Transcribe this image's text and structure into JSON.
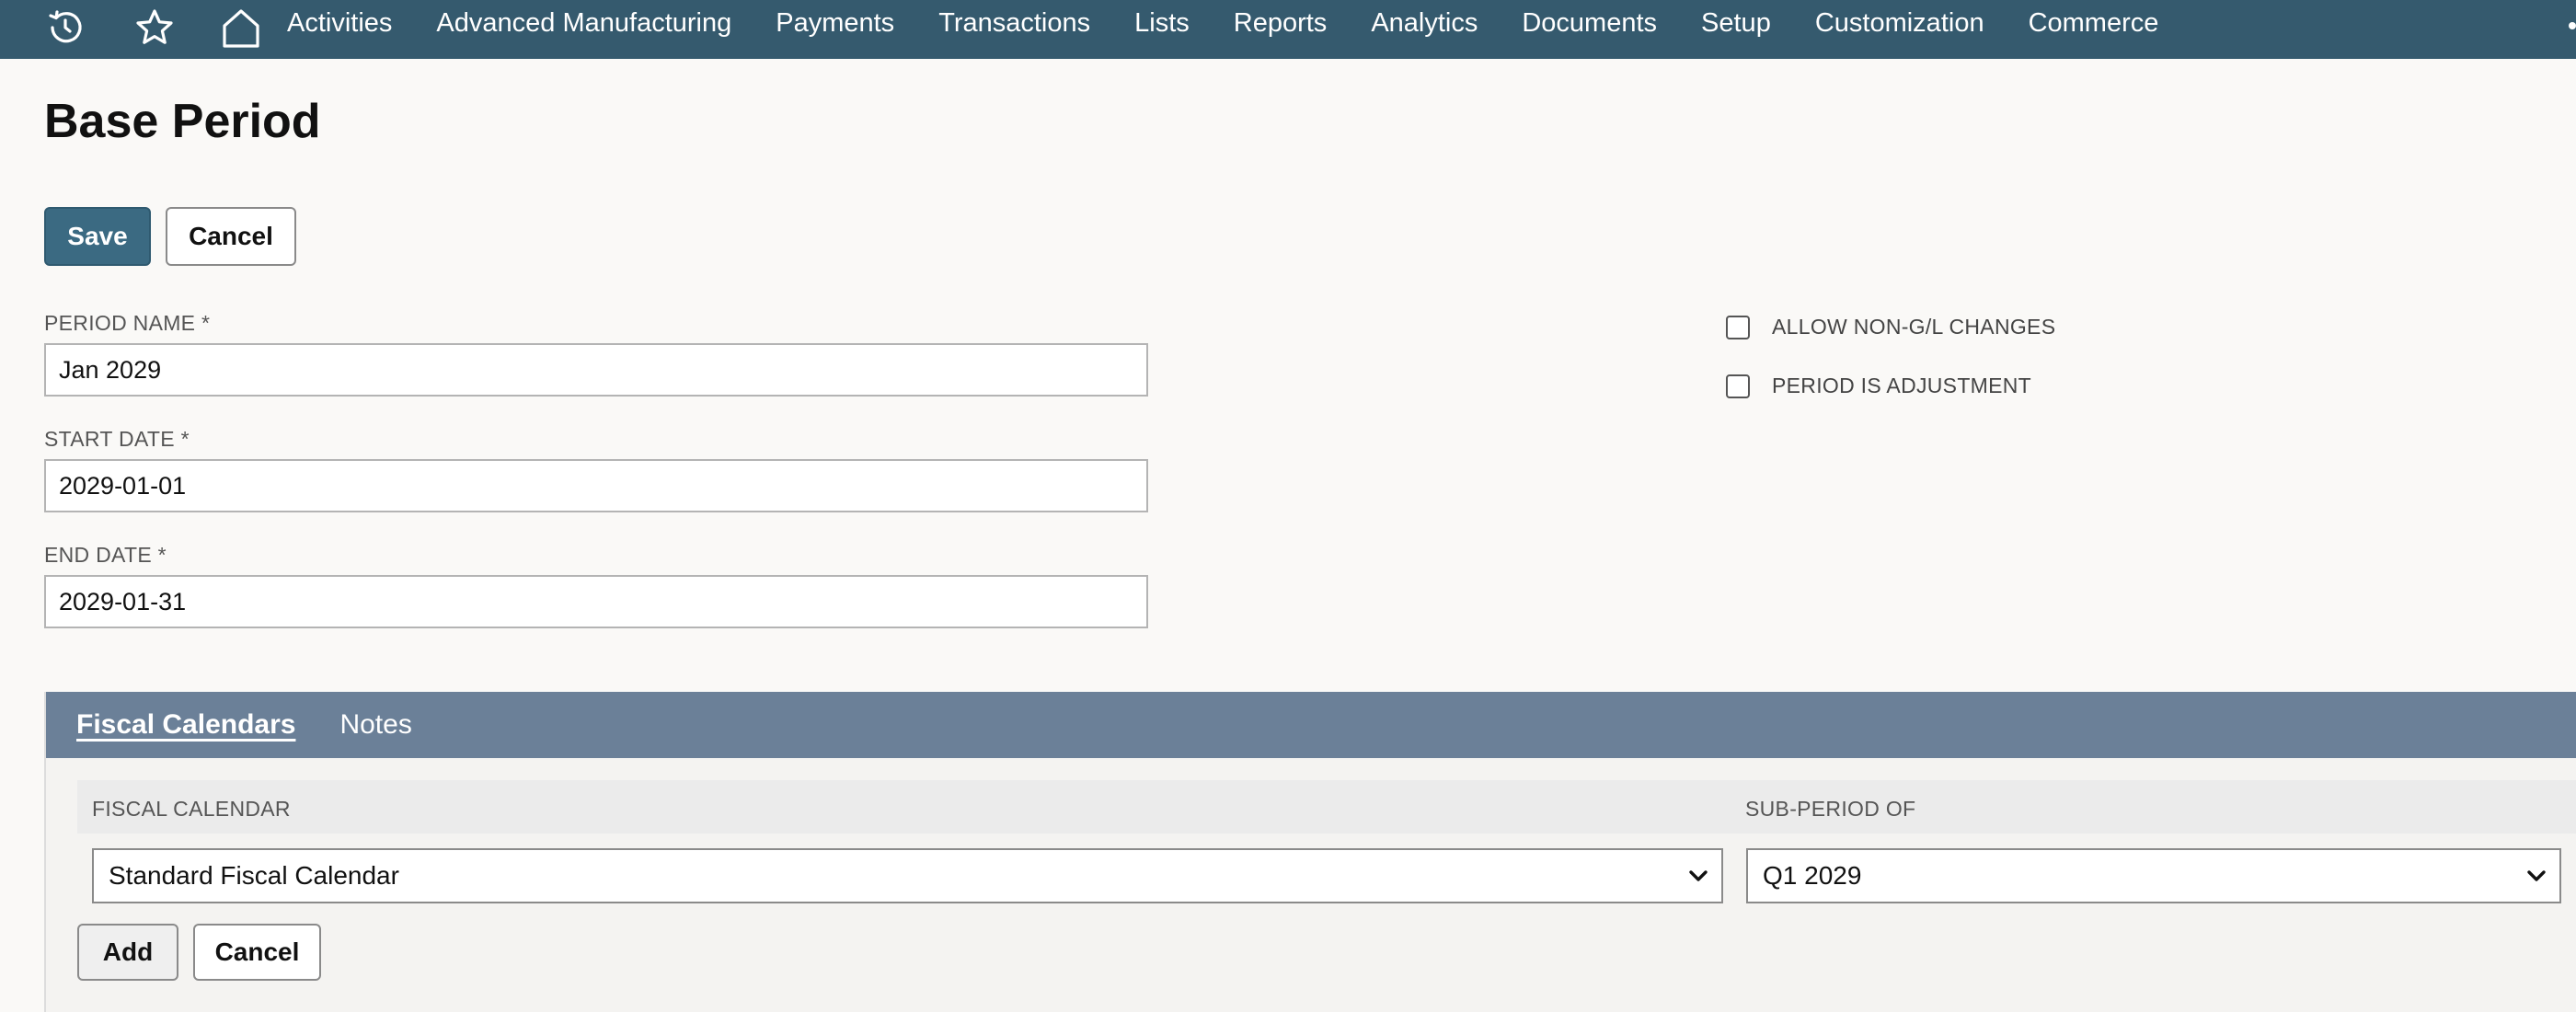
{
  "nav": {
    "icons": [
      "history-icon",
      "star-icon",
      "home-icon"
    ],
    "items": [
      "Activities",
      "Advanced Manufacturing",
      "Payments",
      "Transactions",
      "Lists",
      "Reports",
      "Analytics",
      "Documents",
      "Setup",
      "Customization",
      "Commerce"
    ]
  },
  "page": {
    "title": "Base Period",
    "save_label": "Save",
    "cancel_label": "Cancel"
  },
  "form": {
    "period_name": {
      "label": "PERIOD NAME *",
      "value": "Jan 2029"
    },
    "start_date": {
      "label": "START DATE *",
      "value": "2029-01-01"
    },
    "end_date": {
      "label": "END DATE *",
      "value": "2029-01-31"
    },
    "allow_non_gl": {
      "label": "ALLOW NON-G/L CHANGES",
      "checked": false
    },
    "period_is_adjustment": {
      "label": "PERIOD IS ADJUSTMENT",
      "checked": false
    }
  },
  "subtabs": {
    "tabs": [
      "Fiscal Calendars",
      "Notes"
    ],
    "active": "Fiscal Calendars"
  },
  "grid": {
    "columns": [
      "FISCAL CALENDAR",
      "SUB-PERIOD OF"
    ],
    "fiscal_calendar_value": "Standard Fiscal Calendar",
    "sub_period_value": "Q1 2029",
    "add_label": "Add",
    "cancel_label": "Cancel"
  },
  "colors": {
    "nav_bg": "#355a6e",
    "primary_button": "#3b6a82",
    "tab_bar": "#6b8098"
  }
}
